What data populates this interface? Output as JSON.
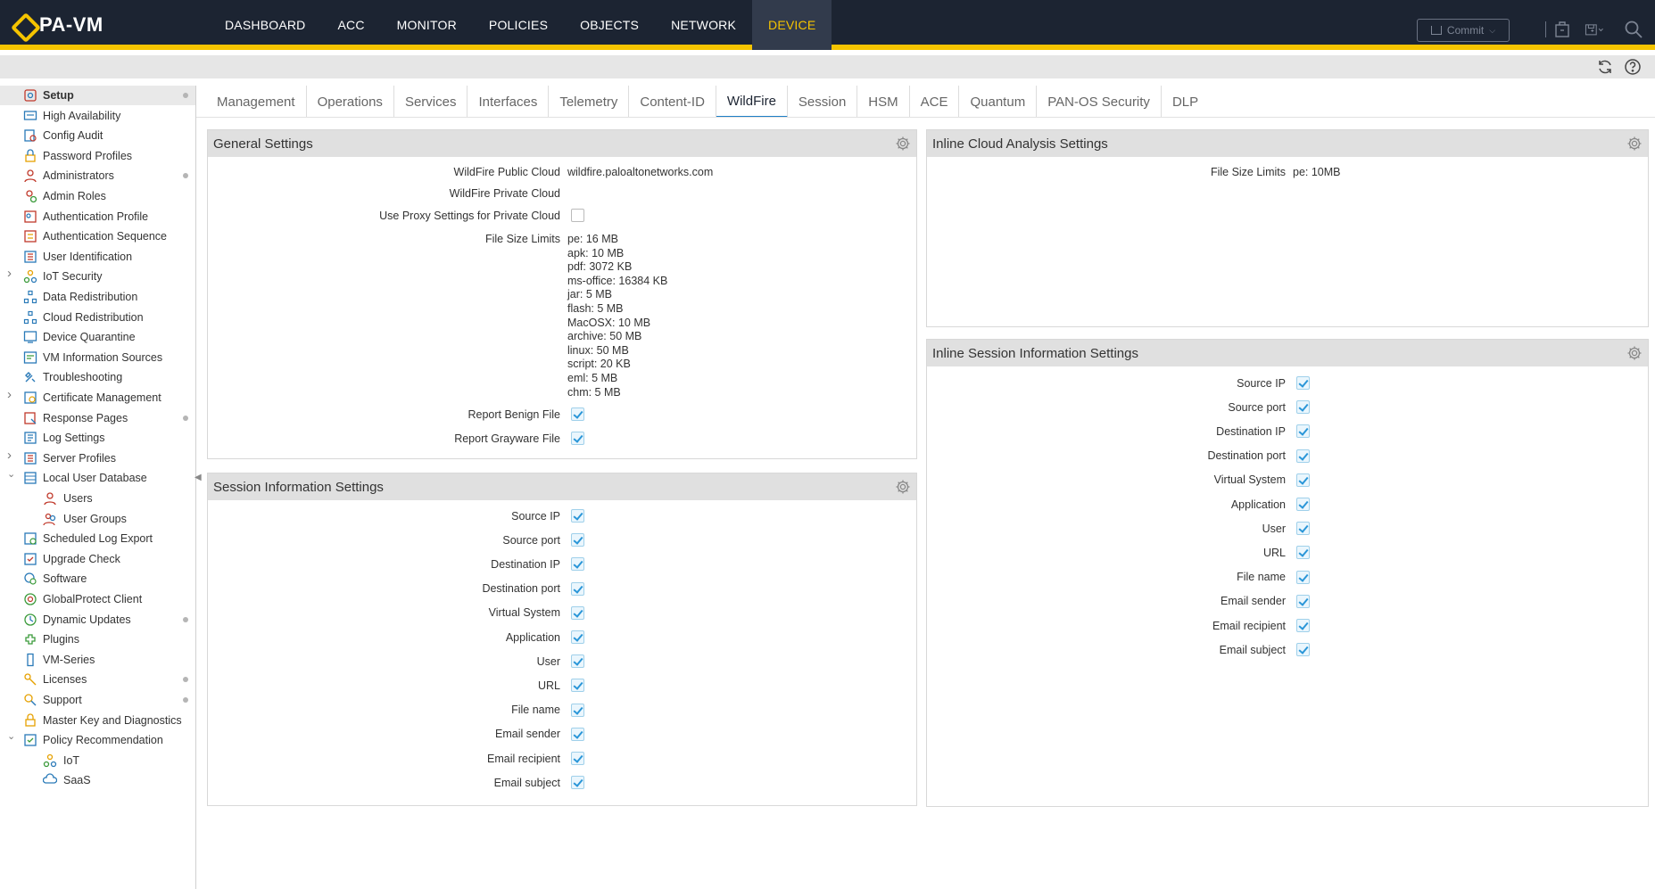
{
  "app": {
    "logo_text": "PA-VM"
  },
  "mainnav": [
    {
      "label": "DASHBOARD"
    },
    {
      "label": "ACC"
    },
    {
      "label": "MONITOR"
    },
    {
      "label": "POLICIES"
    },
    {
      "label": "OBJECTS"
    },
    {
      "label": "NETWORK"
    },
    {
      "label": "DEVICE",
      "active": true
    }
  ],
  "header": {
    "commit_label": "Commit"
  },
  "sidebar": {
    "items": [
      {
        "label": "Setup",
        "active": true,
        "dot": true
      },
      {
        "label": "High Availability"
      },
      {
        "label": "Config Audit"
      },
      {
        "label": "Password Profiles"
      },
      {
        "label": "Administrators",
        "dot": true
      },
      {
        "label": "Admin Roles"
      },
      {
        "label": "Authentication Profile"
      },
      {
        "label": "Authentication Sequence"
      },
      {
        "label": "User Identification"
      },
      {
        "label": "IoT Security",
        "expandable": true
      },
      {
        "label": "Data Redistribution"
      },
      {
        "label": "Cloud Redistribution"
      },
      {
        "label": "Device Quarantine"
      },
      {
        "label": "VM Information Sources"
      },
      {
        "label": "Troubleshooting"
      },
      {
        "label": "Certificate Management",
        "expandable": true
      },
      {
        "label": "Response Pages",
        "dot": true
      },
      {
        "label": "Log Settings"
      },
      {
        "label": "Server Profiles",
        "expandable": true
      },
      {
        "label": "Local User Database",
        "expanded": true
      },
      {
        "label": "Users",
        "child": true
      },
      {
        "label": "User Groups",
        "child": true
      },
      {
        "label": "Scheduled Log Export"
      },
      {
        "label": "Upgrade Check"
      },
      {
        "label": "Software"
      },
      {
        "label": "GlobalProtect Client"
      },
      {
        "label": "Dynamic Updates",
        "dot": true
      },
      {
        "label": "Plugins"
      },
      {
        "label": "VM-Series"
      },
      {
        "label": "Licenses",
        "dot": true
      },
      {
        "label": "Support",
        "dot": true
      },
      {
        "label": "Master Key and Diagnostics"
      },
      {
        "label": "Policy Recommendation",
        "expanded": true
      },
      {
        "label": "IoT",
        "child": true
      },
      {
        "label": "SaaS",
        "child": true
      }
    ]
  },
  "tabs": [
    {
      "label": "Management"
    },
    {
      "label": "Operations"
    },
    {
      "label": "Services"
    },
    {
      "label": "Interfaces"
    },
    {
      "label": "Telemetry"
    },
    {
      "label": "Content-ID"
    },
    {
      "label": "WildFire",
      "active": true
    },
    {
      "label": "Session"
    },
    {
      "label": "HSM"
    },
    {
      "label": "ACE"
    },
    {
      "label": "Quantum"
    },
    {
      "label": "PAN-OS Security"
    },
    {
      "label": "DLP"
    }
  ],
  "general_settings": {
    "title": "General Settings",
    "public_cloud_label": "WildFire Public Cloud",
    "public_cloud_value": "wildfire.paloaltonetworks.com",
    "private_cloud_label": "WildFire Private Cloud",
    "proxy_label": "Use Proxy Settings for Private Cloud",
    "proxy_checked": false,
    "file_size_label": "File Size Limits",
    "file_size_limits": [
      "pe: 16 MB",
      "apk: 10 MB",
      "pdf: 3072 KB",
      "ms-office: 16384 KB",
      "jar: 5 MB",
      "flash: 5 MB",
      "MacOSX: 10 MB",
      "archive: 50 MB",
      "linux: 50 MB",
      "script: 20 KB",
      "eml: 5 MB",
      "chm: 5 MB"
    ],
    "benign_label": "Report Benign File",
    "benign_checked": true,
    "grayware_label": "Report Grayware File",
    "grayware_checked": true
  },
  "session_settings": {
    "title": "Session Information Settings",
    "fields": [
      {
        "label": "Source IP",
        "checked": true
      },
      {
        "label": "Source port",
        "checked": true
      },
      {
        "label": "Destination IP",
        "checked": true
      },
      {
        "label": "Destination port",
        "checked": true
      },
      {
        "label": "Virtual System",
        "checked": true
      },
      {
        "label": "Application",
        "checked": true
      },
      {
        "label": "User",
        "checked": true
      },
      {
        "label": "URL",
        "checked": true
      },
      {
        "label": "File name",
        "checked": true
      },
      {
        "label": "Email sender",
        "checked": true
      },
      {
        "label": "Email recipient",
        "checked": true
      },
      {
        "label": "Email subject",
        "checked": true
      }
    ]
  },
  "inline_cloud": {
    "title": "Inline Cloud Analysis Settings",
    "file_size_label": "File Size Limits",
    "file_size_value": "pe: 10MB"
  },
  "inline_session": {
    "title": "Inline Session Information Settings",
    "fields": [
      {
        "label": "Source IP",
        "checked": true
      },
      {
        "label": "Source port",
        "checked": true
      },
      {
        "label": "Destination IP",
        "checked": true
      },
      {
        "label": "Destination port",
        "checked": true
      },
      {
        "label": "Virtual System",
        "checked": true
      },
      {
        "label": "Application",
        "checked": true
      },
      {
        "label": "User",
        "checked": true
      },
      {
        "label": "URL",
        "checked": true
      },
      {
        "label": "File name",
        "checked": true
      },
      {
        "label": "Email sender",
        "checked": true
      },
      {
        "label": "Email recipient",
        "checked": true
      },
      {
        "label": "Email subject",
        "checked": true
      }
    ]
  },
  "colors": {
    "header_bg": "#1c2432",
    "accent": "#f5c400",
    "check": "#2a96d8",
    "tab_active": "#1e7fc6"
  }
}
